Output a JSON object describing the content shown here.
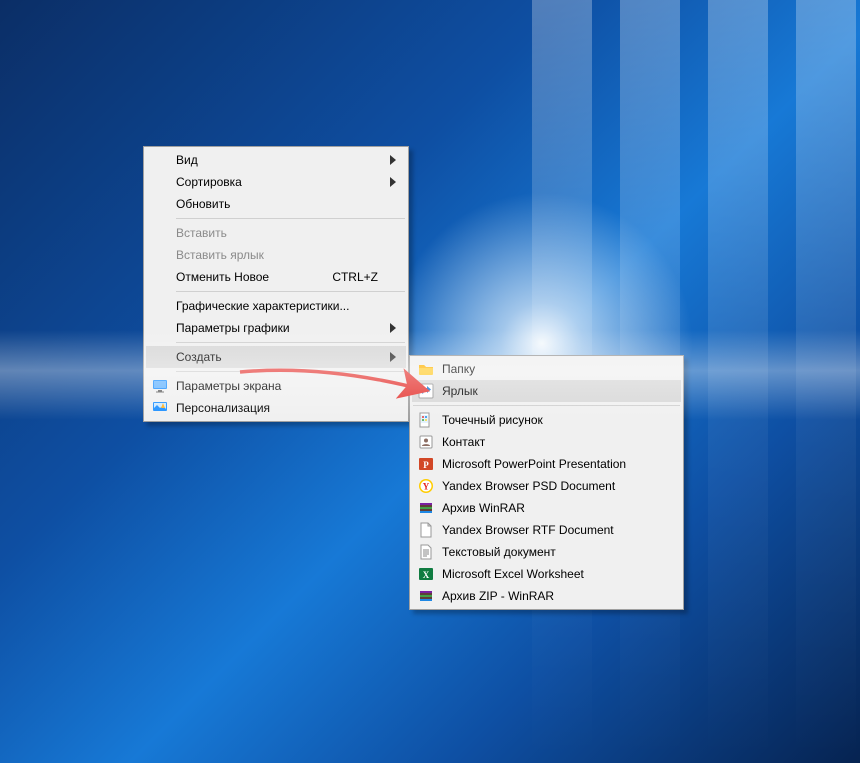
{
  "main_menu": {
    "view": {
      "label": "Вид",
      "submenu": true
    },
    "sort": {
      "label": "Сортировка",
      "submenu": true
    },
    "refresh": {
      "label": "Обновить"
    },
    "paste": {
      "label": "Вставить",
      "disabled": true
    },
    "paste_shortcut": {
      "label": "Вставить ярлык",
      "disabled": true
    },
    "undo": {
      "label": "Отменить Новое",
      "shortcut": "CTRL+Z"
    },
    "gfx_props": {
      "label": "Графические характеристики..."
    },
    "gfx_params": {
      "label": "Параметры графики",
      "submenu": true
    },
    "new": {
      "label": "Создать",
      "submenu": true,
      "highlighted": true
    },
    "display": {
      "label": "Параметры экрана",
      "icon": "monitor-icon"
    },
    "personalize": {
      "label": "Персонализация",
      "icon": "personalize-icon"
    }
  },
  "sub_menu": {
    "folder": {
      "label": "Папку",
      "icon": "folder-icon"
    },
    "shortcut": {
      "label": "Ярлык",
      "icon": "shortcut-icon",
      "highlighted": true
    },
    "bmp": {
      "label": "Точечный рисунок",
      "icon": "paint-icon"
    },
    "contact": {
      "label": "Контакт",
      "icon": "contact-icon"
    },
    "pptx": {
      "label": "Microsoft PowerPoint Presentation",
      "icon": "powerpoint-icon"
    },
    "psd": {
      "label": "Yandex Browser PSD Document",
      "icon": "yandex-icon"
    },
    "rar": {
      "label": "Архив WinRAR",
      "icon": "winrar-icon"
    },
    "rtf": {
      "label": "Yandex Browser RTF Document",
      "icon": "file-icon"
    },
    "txt": {
      "label": "Текстовый документ",
      "icon": "text-icon"
    },
    "xlsx": {
      "label": "Microsoft Excel Worksheet",
      "icon": "excel-icon"
    },
    "zip": {
      "label": "Архив ZIP - WinRAR",
      "icon": "winrar-icon"
    }
  }
}
